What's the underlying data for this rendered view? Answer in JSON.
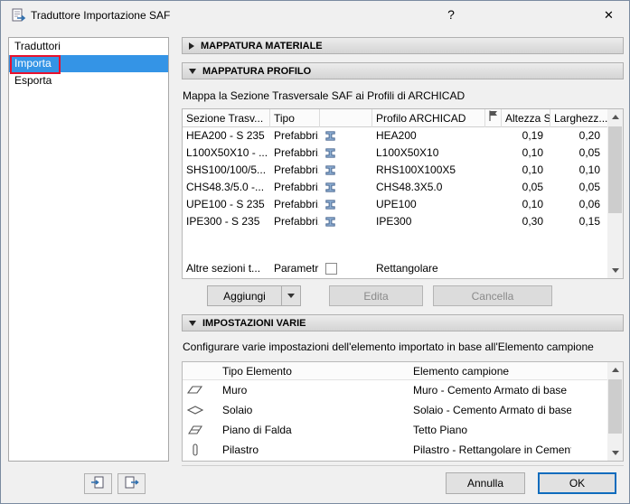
{
  "window": {
    "title": "Traduttore Importazione SAF",
    "help_label": "?",
    "close_label": "✕"
  },
  "sidebar": {
    "header": "Traduttori",
    "items": [
      {
        "label": "Importa",
        "selected": true
      },
      {
        "label": "Esporta",
        "selected": false
      }
    ]
  },
  "sections": {
    "material_label": "MAPPATURA MATERIALE",
    "profile_label": "MAPPATURA PROFILO",
    "varie_label": "IMPOSTAZIONI VARIE"
  },
  "profile_panel": {
    "description": "Mappa la Sezione Trasversale SAF ai Profili di ARCHICAD",
    "columns": {
      "section": "Sezione Trasv...",
      "type": "Tipo",
      "profile": "Profilo ARCHICAD",
      "height": "Altezza S...",
      "width": "Larghezz..."
    },
    "rows": [
      {
        "section": "HEA200 - S 235",
        "type": "Prefabbri...",
        "profile": "HEA200",
        "height": "0,19",
        "width": "0,20"
      },
      {
        "section": "L100X50X10 - ...",
        "type": "Prefabbri...",
        "profile": "L100X50X10",
        "height": "0,10",
        "width": "0,05"
      },
      {
        "section": "SHS100/100/5...",
        "type": "Prefabbri...",
        "profile": "RHS100X100X5",
        "height": "0,10",
        "width": "0,10"
      },
      {
        "section": "CHS48.3/5.0 -...",
        "type": "Prefabbri...",
        "profile": "CHS48.3X5.0",
        "height": "0,05",
        "width": "0,05"
      },
      {
        "section": "UPE100 - S 235",
        "type": "Prefabbri...",
        "profile": "UPE100",
        "height": "0,10",
        "width": "0,06"
      },
      {
        "section": "IPE300 - S 235",
        "type": "Prefabbri...",
        "profile": "IPE300",
        "height": "0,30",
        "width": "0,15"
      }
    ],
    "other_row": {
      "section": "Altre sezioni t...",
      "type": "Parametri...",
      "profile": "Rettangolare"
    },
    "buttons": {
      "add": "Aggiungi",
      "edit": "Edita",
      "delete": "Cancella"
    }
  },
  "varie_panel": {
    "description": "Configurare varie impostazioni dell'elemento importato in base all'Elemento campione",
    "columns": {
      "type": "Tipo Elemento",
      "sample": "Elemento campione"
    },
    "rows": [
      {
        "type": "Muro",
        "sample": "Muro - Cemento Armato di base"
      },
      {
        "type": "Solaio",
        "sample": "Solaio - Cemento Armato di base"
      },
      {
        "type": "Piano di Falda",
        "sample": "Tetto Piano"
      },
      {
        "type": "Pilastro",
        "sample": "Pilastro - Rettangolare in Cemento ..."
      }
    ]
  },
  "footer": {
    "cancel": "Annulla",
    "ok": "OK"
  },
  "colors": {
    "selection_blue": "#3494e6",
    "annotation_red": "#e8112d",
    "default_button_accent": "#0f6cbd",
    "dialog_background": "#f0f0f0"
  }
}
